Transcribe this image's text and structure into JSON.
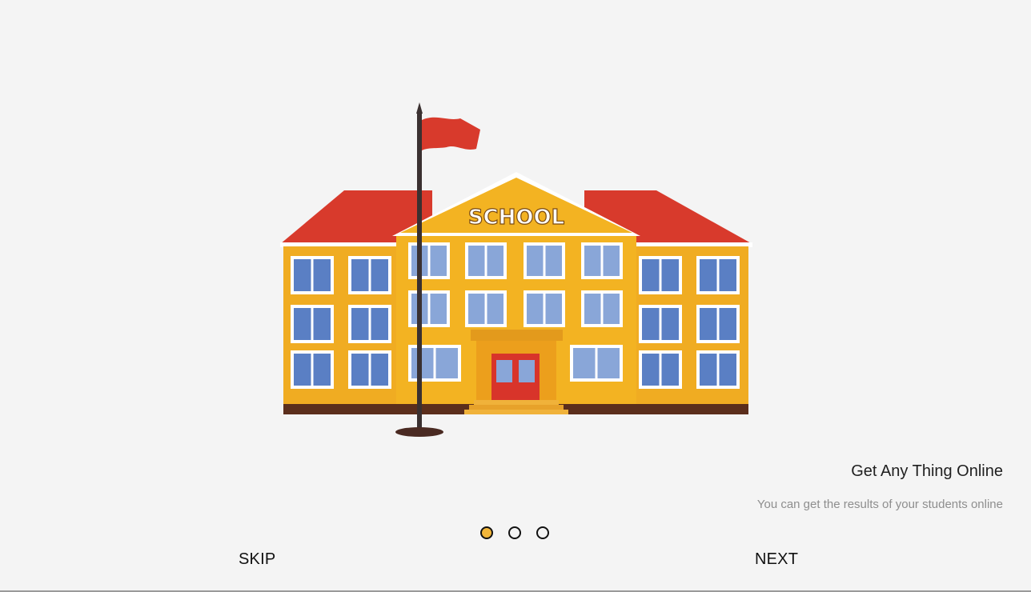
{
  "illustration": {
    "sign_text": "SCHOOL",
    "colors": {
      "roof": "#d83a2c",
      "wall": "#f0ac22",
      "gable": "#f3b322",
      "window": "#5a7fc4",
      "window_light": "#89a6d8",
      "base": "#5b2e1c",
      "flag": "#d83a2c",
      "door": "#d8342a"
    }
  },
  "onboarding": {
    "title": "Get Any Thing Online",
    "subtitle": "You can get the results of your students online",
    "page_count": 3,
    "active_page": 1
  },
  "buttons": {
    "skip_label": "SKIP",
    "next_label": "NEXT"
  },
  "accent_color": "#f2b63a"
}
